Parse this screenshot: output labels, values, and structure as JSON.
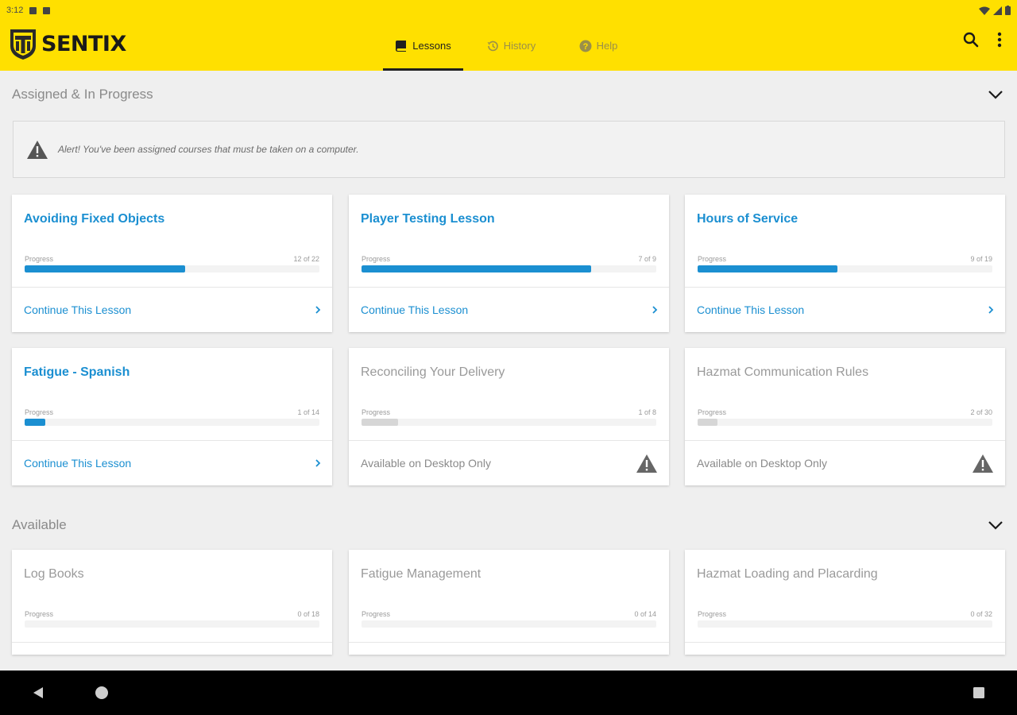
{
  "status_bar": {
    "time": "3:12"
  },
  "app": {
    "brand": "SENTIX",
    "tabs": [
      {
        "label": "Lessons",
        "active": true,
        "icon": "book-icon"
      },
      {
        "label": "History",
        "active": false,
        "icon": "history-icon"
      },
      {
        "label": "Help",
        "active": false,
        "icon": "help-icon"
      }
    ],
    "actions": [
      "search-icon",
      "more-vert-icon"
    ]
  },
  "sections": {
    "assigned": {
      "title": "Assigned & In Progress",
      "alert": "Alert! You've been assigned courses that must be taken on a computer."
    },
    "available": {
      "title": "Available"
    }
  },
  "progress_label": "Progress",
  "assigned_cards": [
    {
      "title": "Avoiding Fixed Objects",
      "count": "12 of 22",
      "progress": 0.545,
      "footer": "Continue This Lesson",
      "desktop_only": false
    },
    {
      "title": "Player Testing Lesson",
      "count": "7 of 9",
      "progress": 0.778,
      "footer": "Continue This Lesson",
      "desktop_only": false
    },
    {
      "title": "Hours of Service",
      "count": "9 of 19",
      "progress": 0.474,
      "footer": "Continue This Lesson",
      "desktop_only": false
    },
    {
      "title": "Fatigue - Spanish",
      "count": "1 of 14",
      "progress": 0.071,
      "footer": "Continue This Lesson",
      "desktop_only": false
    },
    {
      "title": "Reconciling Your Delivery",
      "count": "1 of 8",
      "progress": 0.125,
      "footer": "Available on Desktop Only",
      "desktop_only": true
    },
    {
      "title": "Hazmat Communication Rules",
      "count": "2 of 30",
      "progress": 0.067,
      "footer": "Available on Desktop Only",
      "desktop_only": true
    }
  ],
  "available_cards": [
    {
      "title": "Log Books",
      "count": "0 of 18",
      "progress": 0
    },
    {
      "title": "Fatigue Management",
      "count": "0 of 14",
      "progress": 0
    },
    {
      "title": "Hazmat Loading and Placarding",
      "count": "0 of 32",
      "progress": 0
    }
  ],
  "colors": {
    "brand_yellow": "#ffe000",
    "accent_blue": "#1b8fd1",
    "muted_gray": "#9a9a9a",
    "background": "#efefef"
  }
}
